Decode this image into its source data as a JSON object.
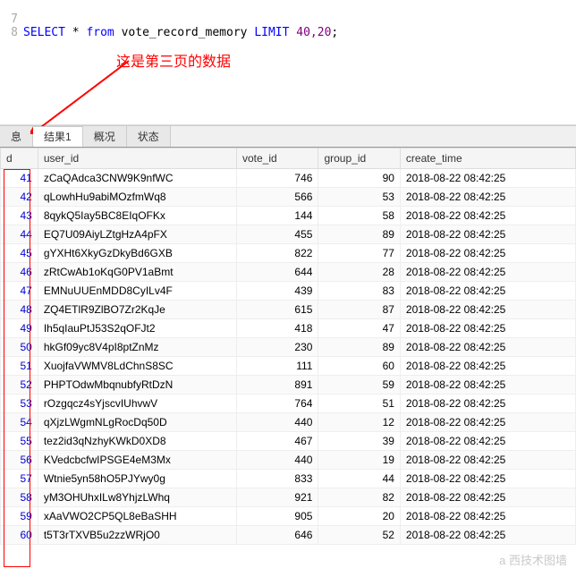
{
  "sql": {
    "line1_num": "7",
    "line2_num": "8",
    "kw_select": "SELECT",
    "star": " * ",
    "kw_from": "from",
    "table": " vote_record_memory ",
    "kw_limit": "LIMIT",
    "args": " 40,20",
    "semi": ";"
  },
  "annotation": "这是第三页的数据",
  "tabs": {
    "t0": "息",
    "t1": "结果1",
    "t2": "概况",
    "t3": "状态"
  },
  "headers": {
    "d": "d",
    "user_id": "user_id",
    "vote_id": "vote_id",
    "group_id": "group_id",
    "create_time": "create_time"
  },
  "rows": [
    {
      "d": "41",
      "user_id": "zCaQAdca3CNW9K9nfWC",
      "vote_id": "746",
      "group_id": "90",
      "create_time": "2018-08-22 08:42:25"
    },
    {
      "d": "42",
      "user_id": "qLowhHu9abiMOzfmWq8",
      "vote_id": "566",
      "group_id": "53",
      "create_time": "2018-08-22 08:42:25"
    },
    {
      "d": "43",
      "user_id": "8qykQ5Iay5BC8EIqOFKx",
      "vote_id": "144",
      "group_id": "58",
      "create_time": "2018-08-22 08:42:25"
    },
    {
      "d": "44",
      "user_id": "EQ7U09AiyLZtgHzA4pFX",
      "vote_id": "455",
      "group_id": "89",
      "create_time": "2018-08-22 08:42:25"
    },
    {
      "d": "45",
      "user_id": "gYXHt6XkyGzDkyBd6GXB",
      "vote_id": "822",
      "group_id": "77",
      "create_time": "2018-08-22 08:42:25"
    },
    {
      "d": "46",
      "user_id": "zRtCwAb1oKqG0PV1aBmt",
      "vote_id": "644",
      "group_id": "28",
      "create_time": "2018-08-22 08:42:25"
    },
    {
      "d": "47",
      "user_id": "EMNuUUEnMDD8CyILv4F",
      "vote_id": "439",
      "group_id": "83",
      "create_time": "2018-08-22 08:42:25"
    },
    {
      "d": "48",
      "user_id": "ZQ4ETlR9ZlBO7Zr2KqJe",
      "vote_id": "615",
      "group_id": "87",
      "create_time": "2018-08-22 08:42:25"
    },
    {
      "d": "49",
      "user_id": "Ih5qIauPtJ53S2qOFJt2",
      "vote_id": "418",
      "group_id": "47",
      "create_time": "2018-08-22 08:42:25"
    },
    {
      "d": "50",
      "user_id": "hkGf09yc8V4pI8ptZnMz",
      "vote_id": "230",
      "group_id": "89",
      "create_time": "2018-08-22 08:42:25"
    },
    {
      "d": "51",
      "user_id": "XuojfaVWMV8LdChnS8SC",
      "vote_id": "111",
      "group_id": "60",
      "create_time": "2018-08-22 08:42:25"
    },
    {
      "d": "52",
      "user_id": "PHPTOdwMbqnubfyRtDzN",
      "vote_id": "891",
      "group_id": "59",
      "create_time": "2018-08-22 08:42:25"
    },
    {
      "d": "53",
      "user_id": "rOzgqcz4sYjscvIUhvwV",
      "vote_id": "764",
      "group_id": "51",
      "create_time": "2018-08-22 08:42:25"
    },
    {
      "d": "54",
      "user_id": "qXjzLWgmNLgRocDq50D",
      "vote_id": "440",
      "group_id": "12",
      "create_time": "2018-08-22 08:42:25"
    },
    {
      "d": "55",
      "user_id": "tez2id3qNzhyKWkD0XD8",
      "vote_id": "467",
      "group_id": "39",
      "create_time": "2018-08-22 08:42:25"
    },
    {
      "d": "56",
      "user_id": "KVedcbcfwIPSGE4eM3Mx",
      "vote_id": "440",
      "group_id": "19",
      "create_time": "2018-08-22 08:42:25"
    },
    {
      "d": "57",
      "user_id": "Wtnie5yn58hO5PJYwy0g",
      "vote_id": "833",
      "group_id": "44",
      "create_time": "2018-08-22 08:42:25"
    },
    {
      "d": "58",
      "user_id": "yM3OHUhxILw8YhjzLWhq",
      "vote_id": "921",
      "group_id": "82",
      "create_time": "2018-08-22 08:42:25"
    },
    {
      "d": "59",
      "user_id": "xAaVWO2CP5QL8eBaSHH",
      "vote_id": "905",
      "group_id": "20",
      "create_time": "2018-08-22 08:42:25"
    },
    {
      "d": "60",
      "user_id": "t5T3rTXVB5u2zzWRjO0",
      "vote_id": "646",
      "group_id": "52",
      "create_time": "2018-08-22 08:42:25"
    }
  ],
  "watermark1": "a 西技术图墙",
  "watermark2": ""
}
